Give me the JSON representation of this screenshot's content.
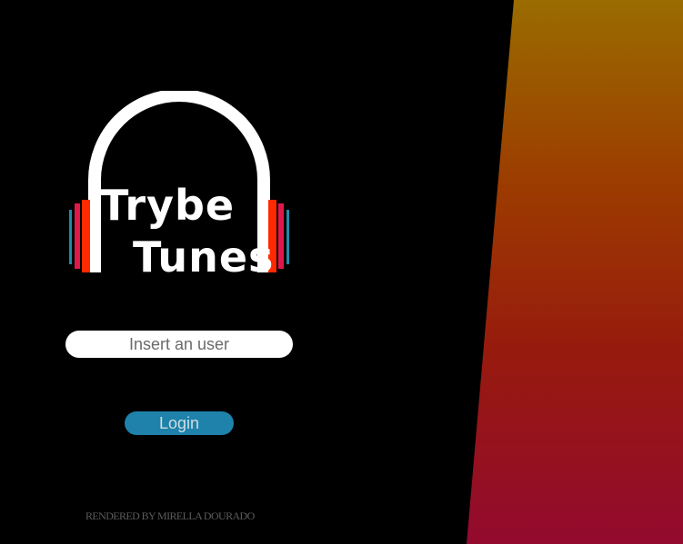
{
  "logo": {
    "line1": "Trybe",
    "line2": "Tunes"
  },
  "login_form": {
    "user_placeholder": "Insert an user",
    "user_value": "",
    "login_label": "Login"
  },
  "footer": {
    "credit": "RENDERED BY MIRELLA DOURADO"
  },
  "colors": {
    "background": "#000000",
    "gradient_top": "#9a6c00",
    "gradient_bottom": "#930a2e",
    "button": "#1e82aa",
    "logo_bar_red": "#ff2a00",
    "logo_bar_crimson": "#e0184a",
    "logo_bar_blue": "#1e8aa6"
  },
  "icons": {
    "logo": "headphones-icon"
  }
}
